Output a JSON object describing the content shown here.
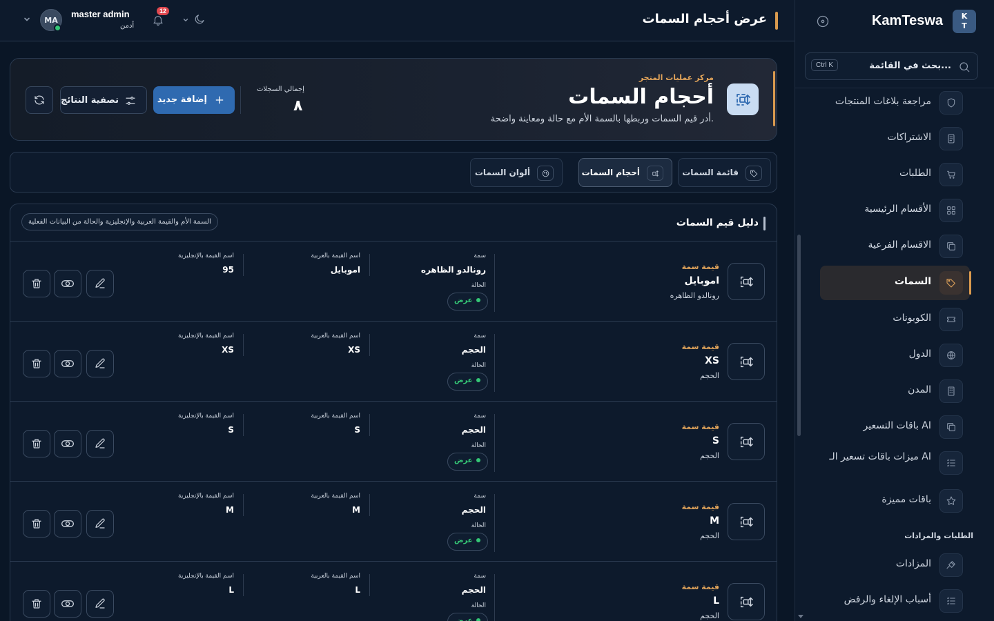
{
  "sidebar": {
    "brand_badge": "K\nT",
    "brand_name": "KamTeswa",
    "search_placeholder": "بحث في القائمة...",
    "search_shortcut": "Ctrl K",
    "items": [
      {
        "label": "مراجعة بلاغات المنتجات",
        "icon": "shield-icon"
      },
      {
        "label": "الاشتراكات",
        "icon": "document-icon"
      },
      {
        "label": "الطلبات",
        "icon": "cart-icon"
      },
      {
        "label": "الأقسام الرئيسية",
        "icon": "grid-icon"
      },
      {
        "label": "الاقسام الفرعية",
        "icon": "copy-icon"
      },
      {
        "label": "السمات",
        "icon": "tag-icon",
        "active": true
      },
      {
        "label": "الكوبونات",
        "icon": "ticket-icon"
      },
      {
        "label": "الدول",
        "icon": "globe-icon"
      },
      {
        "label": "المدن",
        "icon": "building-icon"
      },
      {
        "label": "باقات التسعير AI",
        "icon": "copy-icon"
      },
      {
        "label": "ميزات باقات تسعير الـ AI",
        "icon": "list-icon"
      },
      {
        "label": "باقات مميزة",
        "icon": "star-icon"
      }
    ],
    "section_title": "الطلبات والمزادات",
    "section_items": [
      {
        "label": "المزادات",
        "icon": "gavel-icon"
      },
      {
        "label": "أسباب الإلغاء والرفض",
        "icon": "list-icon"
      }
    ]
  },
  "topbar": {
    "page_title": "عرض أحجام السمات",
    "user_name": "master admin",
    "user_role": "أدمن",
    "avatar_initials": "MA",
    "notification_count": "12"
  },
  "hero": {
    "eyebrow": "مركز عمليات المتجر",
    "title": "أحجام السمات",
    "subtitle": "أدر قيم السمات وربطها بالسمة الأم مع حالة ومعاينة واضحة.",
    "records_label": "إجمالي السجلات",
    "records_value": "٨",
    "add_label": "إضافة جديد",
    "filter_label": "تصفية النتائج"
  },
  "tabs": [
    {
      "label": "قائمة السمات",
      "icon": "tag-icon"
    },
    {
      "label": "أحجام السمات",
      "icon": "resize-icon",
      "active": true
    },
    {
      "label": "ألوان السمات",
      "icon": "palette-icon"
    }
  ],
  "list": {
    "title": "دليل قيم السمات",
    "hint": "السمة الأم والقيمة العربية والإنجليزية والحالة من البيانات الفعلية",
    "labels": {
      "kind": "قيمة سمة",
      "attribute": "سمة",
      "status": "الحالة",
      "name_ar": "اسم القيمة بالعربية",
      "name_en": "اسم القيمة بالإنجليزية"
    },
    "rows": [
      {
        "value": "اموبايل",
        "parent": "رونالدو الظاهره",
        "name_ar": "اموبايل",
        "name_en": "95",
        "status": "عرض"
      },
      {
        "value": "XS",
        "parent": "الحجم",
        "name_ar": "XS",
        "name_en": "XS",
        "status": "عرض"
      },
      {
        "value": "S",
        "parent": "الحجم",
        "name_ar": "S",
        "name_en": "S",
        "status": "عرض"
      },
      {
        "value": "M",
        "parent": "الحجم",
        "name_ar": "M",
        "name_en": "M",
        "status": "عرض"
      },
      {
        "value": "L",
        "parent": "الحجم",
        "name_ar": "L",
        "name_en": "L",
        "status": "عرض"
      }
    ]
  },
  "colors": {
    "accent": "#d99a4e",
    "primary": "#2f6ab0",
    "success": "#35c776",
    "danger": "#e0484f",
    "background": "#0a1626"
  }
}
